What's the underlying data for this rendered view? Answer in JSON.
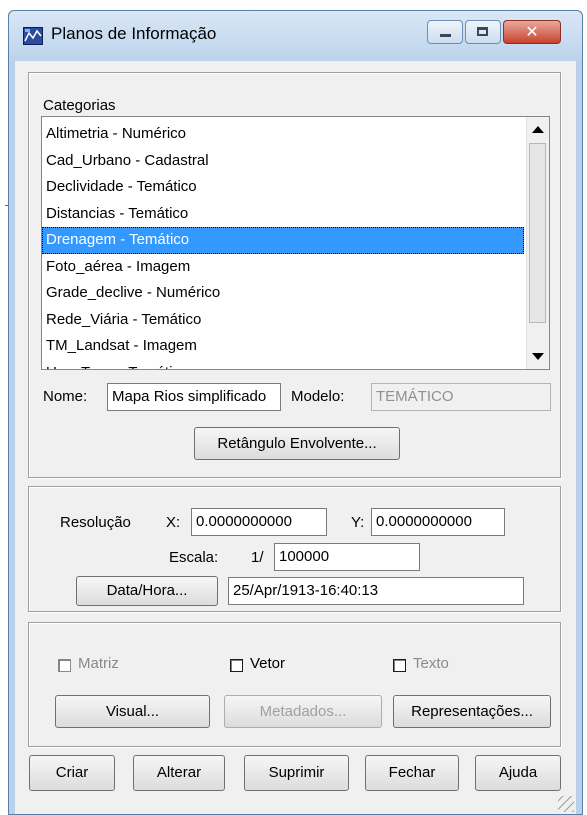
{
  "window": {
    "title": "Planos de Informação",
    "close_symbol": "✕"
  },
  "categories": {
    "label": "Categorias",
    "items": [
      "Altimetria - Numérico",
      "Cad_Urbano - Cadastral",
      "Declividade - Temático",
      "Distancias - Temático",
      "Drenagem - Temático",
      "Foto_aérea - Imagem",
      "Grade_declive - Numérico",
      "Rede_Viária - Temático",
      "TM_Landsat - Imagem",
      "Uso_Terra - Temático"
    ],
    "selected": "Drenagem - Temático"
  },
  "nome": {
    "label": "Nome:",
    "value": "Mapa Rios simplificado"
  },
  "modelo": {
    "label": "Modelo:",
    "value": "TEMÁTICO"
  },
  "retangulo_button": "Retângulo Envolvente...",
  "resolucao": {
    "label": "Resolução",
    "x_label": "X:",
    "x_value": "0.0000000000",
    "y_label": "Y:",
    "y_value": "0.0000000000"
  },
  "escala": {
    "label": "Escala:",
    "prefix": "1/",
    "value": "100000"
  },
  "datahora": {
    "button": "Data/Hora...",
    "value": "25/Apr/1913-16:40:13"
  },
  "options": {
    "matriz": "Matriz",
    "vetor": "Vetor",
    "texto": "Texto"
  },
  "option_buttons": {
    "visual": "Visual...",
    "metadados": "Metadados...",
    "representacoes": "Representações..."
  },
  "actions": {
    "criar": "Criar",
    "alterar": "Alterar",
    "suprimir": "Suprimir",
    "fechar": "Fechar",
    "ajuda": "Ajuda"
  },
  "colors": {
    "selection": "#3399ff",
    "titlebar": "#bcd3ec",
    "close": "#c8432e"
  },
  "icons": [
    "app-map-icon",
    "minimize-icon",
    "maximize-icon",
    "close-icon",
    "scroll-up-icon",
    "scroll-down-icon",
    "resize-grip-icon"
  ]
}
